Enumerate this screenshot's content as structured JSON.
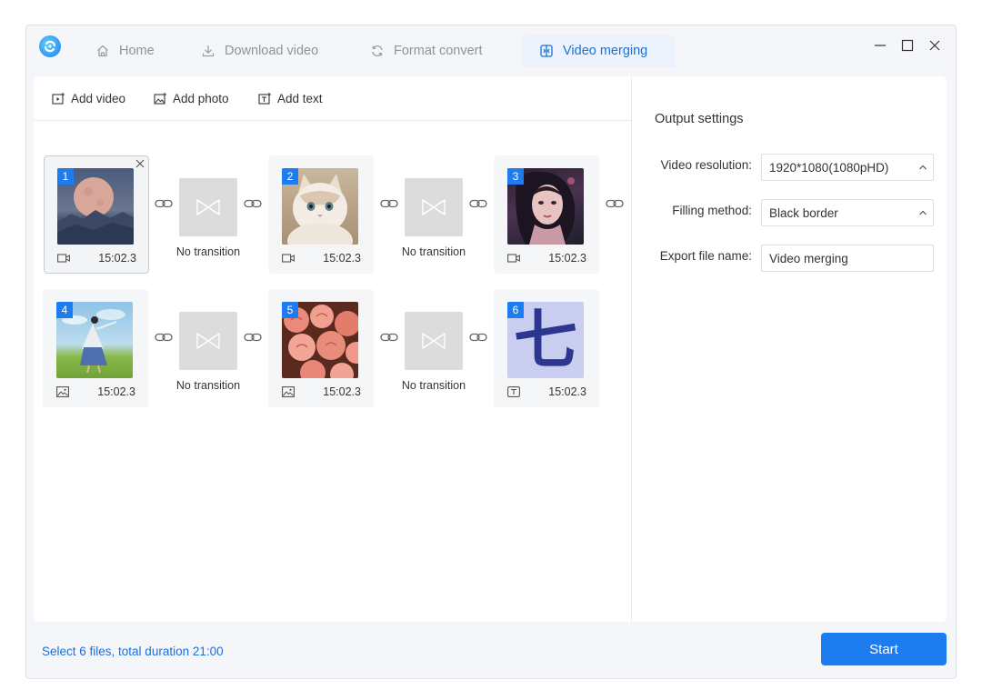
{
  "tabs": [
    {
      "label": "Home",
      "icon": "home-icon"
    },
    {
      "label": "Download video",
      "icon": "download-icon"
    },
    {
      "label": "Format convert",
      "icon": "refresh-icon"
    },
    {
      "label": "Video merging",
      "icon": "merge-icon",
      "active": true
    }
  ],
  "toolbar": {
    "add_video": "Add video",
    "add_photo": "Add photo",
    "add_text": "Add text"
  },
  "clips": [
    {
      "index": "1",
      "duration": "15:02.3",
      "type": "video",
      "thumbnail": "moon-over-mountains"
    },
    {
      "index": "2",
      "duration": "15:02.3",
      "type": "video",
      "thumbnail": "white-cat"
    },
    {
      "index": "3",
      "duration": "15:02.3",
      "type": "video",
      "thumbnail": "woman-portrait"
    },
    {
      "index": "4",
      "duration": "15:02.3",
      "type": "photo",
      "thumbnail": "girl-in-field"
    },
    {
      "index": "5",
      "duration": "15:02.3",
      "type": "photo",
      "thumbnail": "pink-roses"
    },
    {
      "index": "6",
      "duration": "15:02.3",
      "type": "text",
      "thumbnail": "chinese-character",
      "glyph": "七"
    }
  ],
  "transition_label": "No transition",
  "settings": {
    "title": "Output settings",
    "resolution_label": "Video resolution:",
    "resolution_value": "1920*1080(1080pHD)",
    "filling_label": "Filling method:",
    "filling_value": "Black border",
    "filename_label": "Export file name:",
    "filename_value": "Video merging"
  },
  "footer": {
    "status": "Select 6 files, total duration 21:00",
    "start_label": "Start"
  },
  "colors": {
    "accent": "#1d7cf0",
    "accent_text": "#1c6fd9",
    "panel_bg": "#ffffff",
    "window_bg": "#f4f6f9"
  }
}
